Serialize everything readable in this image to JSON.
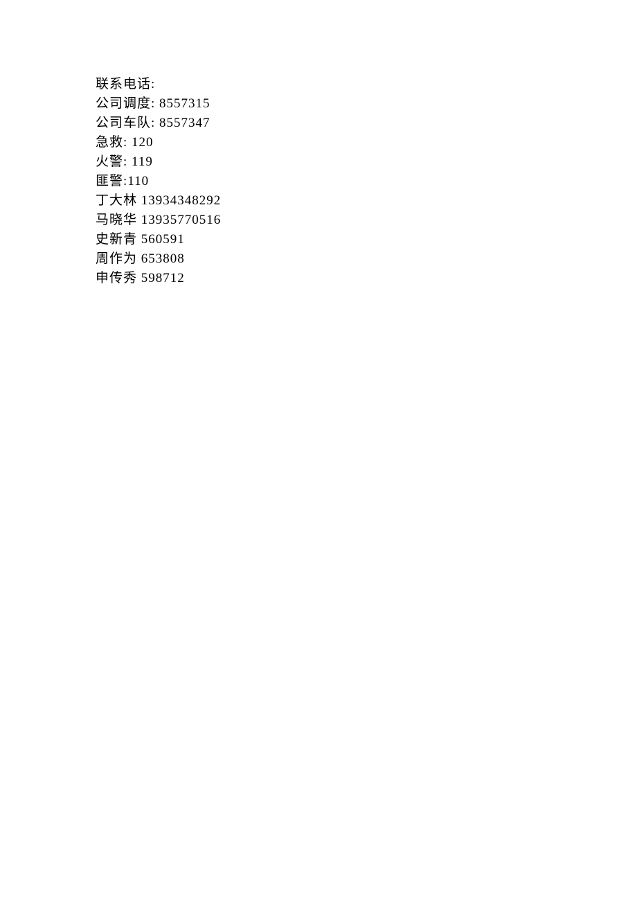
{
  "header": "联系电话:",
  "lines": [
    "公司调度: 8557315",
    "公司车队: 8557347",
    "急救: 120",
    "火警: 119",
    "匪警:110",
    "丁大林 13934348292",
    "马晓华 13935770516",
    "史新青 560591",
    "周作为 653808",
    "申传秀 598712"
  ]
}
